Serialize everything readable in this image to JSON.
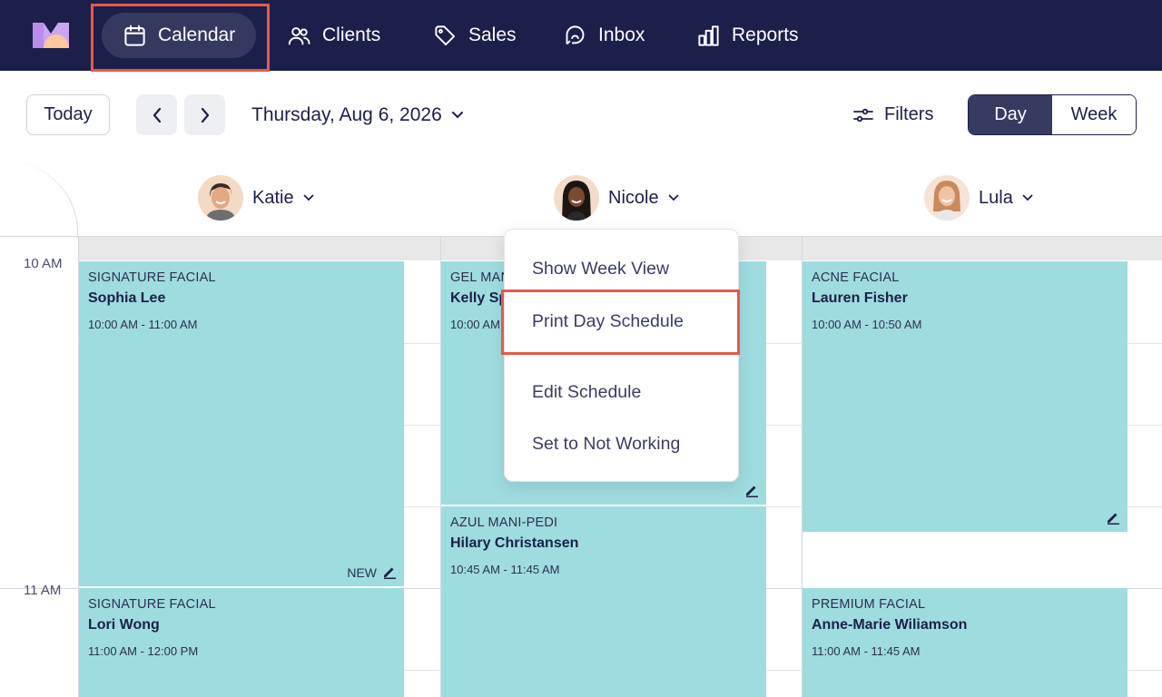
{
  "nav": {
    "items": [
      {
        "label": "Calendar",
        "icon": "calendar-icon",
        "active": true
      },
      {
        "label": "Clients",
        "icon": "clients-icon"
      },
      {
        "label": "Sales",
        "icon": "tag-icon"
      },
      {
        "label": "Inbox",
        "icon": "inbox-icon"
      },
      {
        "label": "Reports",
        "icon": "reports-icon"
      }
    ]
  },
  "toolbar": {
    "today_label": "Today",
    "date_label": "Thursday, Aug 6, 2026",
    "filters_label": "Filters",
    "view_day": "Day",
    "view_week": "Week",
    "selected_view": "Day"
  },
  "staff": [
    {
      "name": "Katie"
    },
    {
      "name": "Nicole"
    },
    {
      "name": "Lula"
    }
  ],
  "time_labels": [
    "10 AM",
    "11 AM"
  ],
  "appointments": {
    "katie": [
      {
        "service": "SIGNATURE FACIAL",
        "client": "Sophia Lee",
        "time": "10:00 AM - 11:00 AM",
        "tag": "NEW"
      },
      {
        "service": "SIGNATURE FACIAL",
        "client": "Lori Wong",
        "time": "11:00 AM - 12:00 PM"
      }
    ],
    "nicole": [
      {
        "service": "GEL MANI",
        "client": "Kelly Sp",
        "time": "10:00 AM"
      },
      {
        "service": "AZUL MANI-PEDI",
        "client": "Hilary Christansen",
        "time": "10:45 AM - 11:45 AM"
      }
    ],
    "lula": [
      {
        "service": "ACNE FACIAL",
        "client": "Lauren Fisher",
        "time": "10:00 AM - 10:50 AM"
      },
      {
        "service": "PREMIUM FACIAL",
        "client": "Anne-Marie Wiliamson",
        "time": "11:00 AM - 11:45 AM"
      }
    ]
  },
  "staff_menu": {
    "items": [
      "Show Week View",
      "Print Day Schedule",
      "Edit Schedule",
      "Set to Not Working"
    ],
    "highlighted": "Print Day Schedule"
  },
  "colors": {
    "nav_bg": "#1c1f4a",
    "appointment": "#9fdcdf",
    "highlight": "#e45a4a",
    "active_toggle": "#373b62"
  }
}
